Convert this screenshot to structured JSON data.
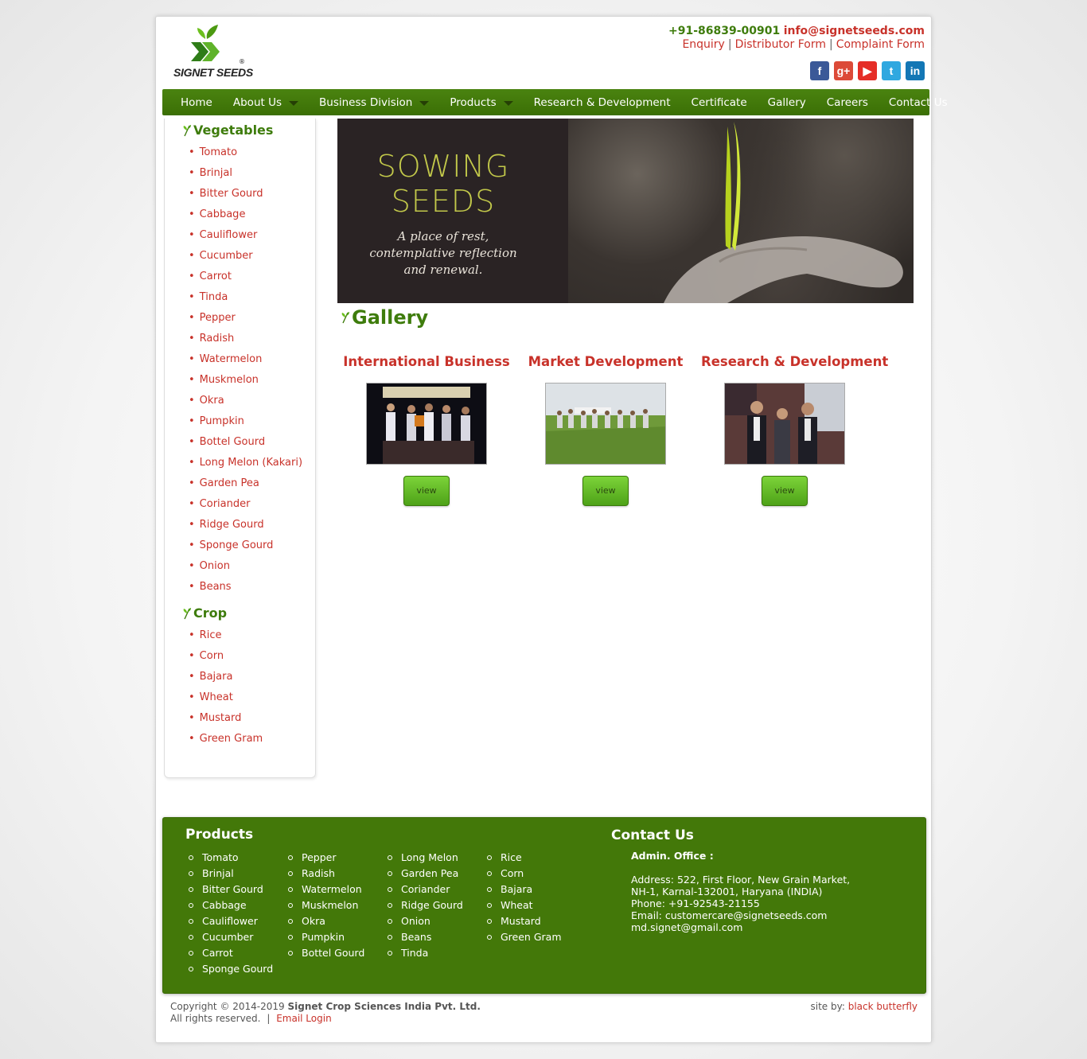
{
  "header": {
    "logo_text": "SIGNET SEEDS",
    "logo_reg": "®",
    "phone": "+91-86839-00901",
    "email": "info@signetseeds.com",
    "links": [
      "Enquiry",
      "Distributor Form",
      "Complaint Form"
    ],
    "social": [
      {
        "icon": "facebook-icon",
        "glyph": "f",
        "color": "#3b5998"
      },
      {
        "icon": "google-plus-icon",
        "glyph": "g+",
        "color": "#dc4a38"
      },
      {
        "icon": "youtube-icon",
        "glyph": "▶",
        "color": "#e52d27"
      },
      {
        "icon": "twitter-icon",
        "glyph": "t",
        "color": "#2fa8e0"
      },
      {
        "icon": "linkedin-icon",
        "glyph": "in",
        "color": "#1377b5"
      }
    ]
  },
  "nav": [
    {
      "label": "Home",
      "dropdown": false
    },
    {
      "label": "About Us",
      "dropdown": true
    },
    {
      "label": "Business Division",
      "dropdown": true
    },
    {
      "label": "Products",
      "dropdown": true
    },
    {
      "label": "Research & Development",
      "dropdown": false
    },
    {
      "label": "Certificate",
      "dropdown": false
    },
    {
      "label": "Gallery",
      "dropdown": false
    },
    {
      "label": "Careers",
      "dropdown": false
    },
    {
      "label": "Contact Us",
      "dropdown": false
    }
  ],
  "sidebar": {
    "vegetables_heading": "Vegetables",
    "vegetables": [
      "Tomato",
      "Brinjal",
      "Bitter Gourd",
      "Cabbage",
      "Cauliflower",
      "Cucumber",
      "Carrot",
      "Tinda",
      "Pepper",
      "Radish",
      "Watermelon",
      "Muskmelon",
      "Okra",
      "Pumpkin",
      "Bottel Gourd",
      "Long Melon (Kakari)",
      "Garden Pea",
      "Coriander",
      "Ridge Gourd",
      "Sponge Gourd",
      "Onion",
      "Beans"
    ],
    "crop_heading": "Crop",
    "crops": [
      "Rice",
      "Corn",
      "Bajara",
      "Wheat",
      "Mustard",
      "Green Gram"
    ]
  },
  "banner": {
    "title_line1": "SOWING",
    "title_line2": "SEEDS",
    "sub_line1": "A place of rest,",
    "sub_line2": "contemplative reflection",
    "sub_line3": "and renewal."
  },
  "main": {
    "heading": "Gallery",
    "cards": [
      {
        "title": "International Business",
        "button": "view"
      },
      {
        "title": "Market Development",
        "button": "view"
      },
      {
        "title": "Research & Development",
        "button": "view"
      }
    ]
  },
  "footer": {
    "products_heading": "Products",
    "col1": [
      "Tomato",
      "Brinjal",
      "Bitter Gourd",
      "Cabbage",
      "Cauliflower",
      "Cucumber",
      "Carrot",
      "Sponge Gourd"
    ],
    "col2": [
      "Pepper",
      "Radish",
      "Watermelon",
      "Muskmelon",
      "Okra",
      "Pumpkin",
      "Bottel Gourd"
    ],
    "col3": [
      "Long Melon",
      "Garden Pea",
      "Coriander",
      "Ridge Gourd",
      "Onion",
      "Beans",
      "Tinda"
    ],
    "col4": [
      "Rice",
      "Corn",
      "Bajara",
      "Wheat",
      "Mustard",
      "Green Gram"
    ],
    "contact_heading": "Contact Us",
    "office": "Admin. Office :",
    "address_line1": "Address: 522, First Floor, New Grain Market,",
    "address_line2": "NH-1, Karnal-132001, Haryana (INDIA)",
    "phone": "Phone: +91-92543-21155",
    "email1": "Email: customercare@signetseeds.com",
    "email2": "md.signet@gmail.com"
  },
  "bottom": {
    "copyright_prefix": "Copyright © 2014-2019",
    "company": "Signet Crop Sciences India Pvt. Ltd.",
    "rights": "All rights reserved.",
    "sep": "|",
    "email_login": "Email Login",
    "siteby_label": "site by:",
    "siteby_link": "black butterfly"
  },
  "colors": {
    "brand_green": "#3e7c0c",
    "accent_red": "#c8322a",
    "footer_green": "#437809"
  }
}
